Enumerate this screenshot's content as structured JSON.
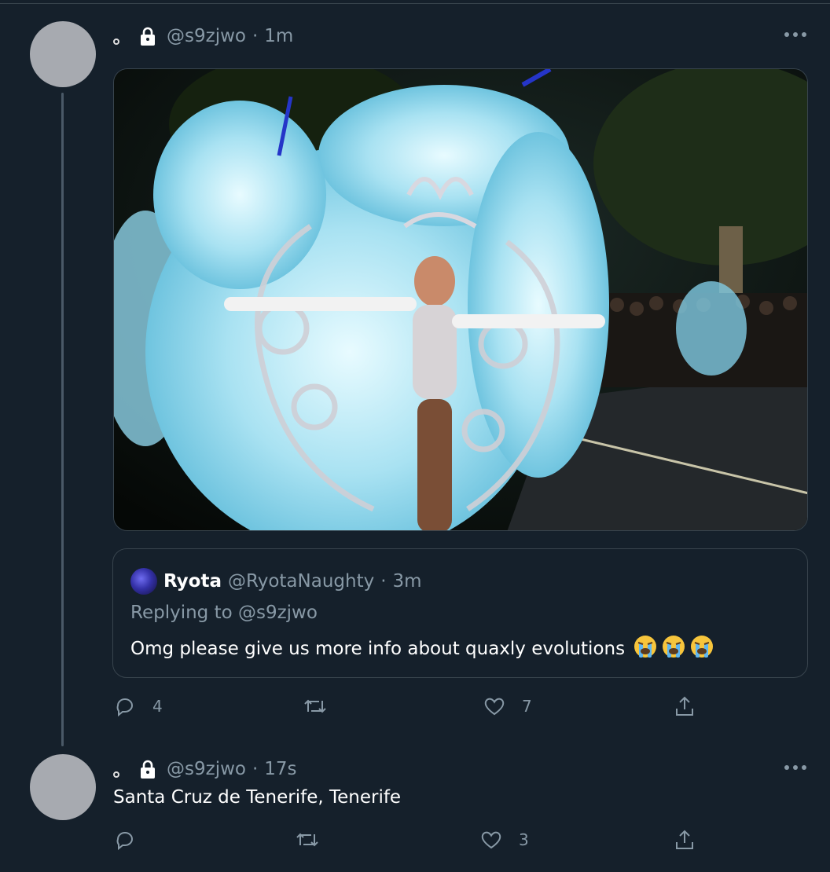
{
  "tweets": [
    {
      "handle": "@s9zjwo",
      "separator": "·",
      "time": "1m",
      "quote": {
        "name": "Ryota",
        "handle": "@RyotaNaughty",
        "separator": "·",
        "time": "3m",
        "replying_to": "Replying to @s9zjwo",
        "text": "Omg please give us more info about quaxly evolutions",
        "emojis": [
          "loudly-crying-face",
          "loudly-crying-face",
          "loudly-crying-face"
        ]
      },
      "actions": {
        "reply_count": "4",
        "retweet_count": "",
        "like_count": "7"
      }
    },
    {
      "handle": "@s9zjwo",
      "separator": "·",
      "time": "17s",
      "text": "Santa Cruz de Tenerife, Tenerife",
      "actions": {
        "reply_count": "",
        "retweet_count": "",
        "like_count": "3"
      }
    }
  ],
  "colors": {
    "background": "#15202b",
    "border": "#38444d",
    "muted_text": "#8899a6",
    "primary_text": "#ffffff",
    "avatar_placeholder": "#a7aab0"
  },
  "icons": {
    "lock": "lock-icon",
    "more": "more-horizontal-icon",
    "reply": "reply-icon",
    "retweet": "retweet-icon",
    "like": "heart-icon",
    "share": "share-icon"
  }
}
